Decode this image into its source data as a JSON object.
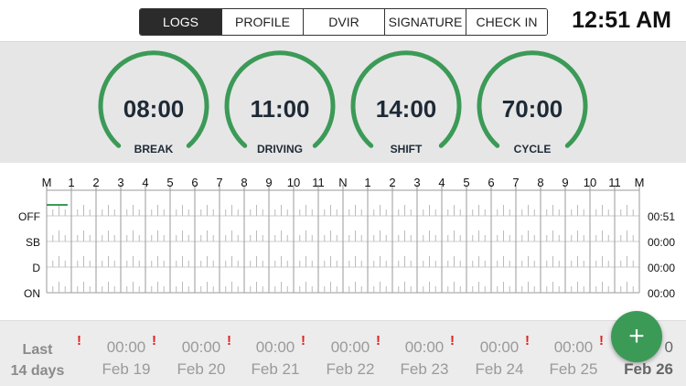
{
  "tabs": [
    {
      "label": "LOGS",
      "active": true
    },
    {
      "label": "PROFILE",
      "active": false
    },
    {
      "label": "DVIR",
      "active": false
    },
    {
      "label": "SIGNATURE",
      "active": false
    },
    {
      "label": "CHECK IN",
      "active": false
    }
  ],
  "clock": "12:51 AM",
  "gauges": [
    {
      "value": "08:00",
      "label": "BREAK"
    },
    {
      "value": "11:00",
      "label": "DRIVING"
    },
    {
      "value": "14:00",
      "label": "SHIFT"
    },
    {
      "value": "70:00",
      "label": "CYCLE"
    }
  ],
  "graph": {
    "hours": [
      "M",
      "1",
      "2",
      "3",
      "4",
      "5",
      "6",
      "7",
      "8",
      "9",
      "10",
      "11",
      "N",
      "1",
      "2",
      "3",
      "4",
      "5",
      "6",
      "7",
      "8",
      "9",
      "10",
      "11",
      "M"
    ],
    "rows": [
      {
        "label": "OFF",
        "total": "00:51"
      },
      {
        "label": "SB",
        "total": "00:00"
      },
      {
        "label": "D",
        "total": "00:00"
      },
      {
        "label": "ON",
        "total": "00:00"
      }
    ]
  },
  "last_days": {
    "line1": "Last",
    "line2": "14 days"
  },
  "days": [
    {
      "hours": "00:00",
      "date": "Feb 19",
      "flag": "!"
    },
    {
      "hours": "00:00",
      "date": "Feb 20",
      "flag": "!"
    },
    {
      "hours": "00:00",
      "date": "Feb 21",
      "flag": "!"
    },
    {
      "hours": "00:00",
      "date": "Feb 22",
      "flag": "!"
    },
    {
      "hours": "00:00",
      "date": "Feb 23",
      "flag": "!"
    },
    {
      "hours": "00:00",
      "date": "Feb 24",
      "flag": "!"
    },
    {
      "hours": "00:00",
      "date": "Feb 25",
      "flag": "!"
    },
    {
      "hours": "0",
      "date": "Feb 26",
      "flag": "!"
    }
  ],
  "fab_symbol": "+",
  "colors": {
    "accent_green": "#3c9a57",
    "flag_red": "#e02020",
    "active_tab": "#2b2b2b"
  }
}
